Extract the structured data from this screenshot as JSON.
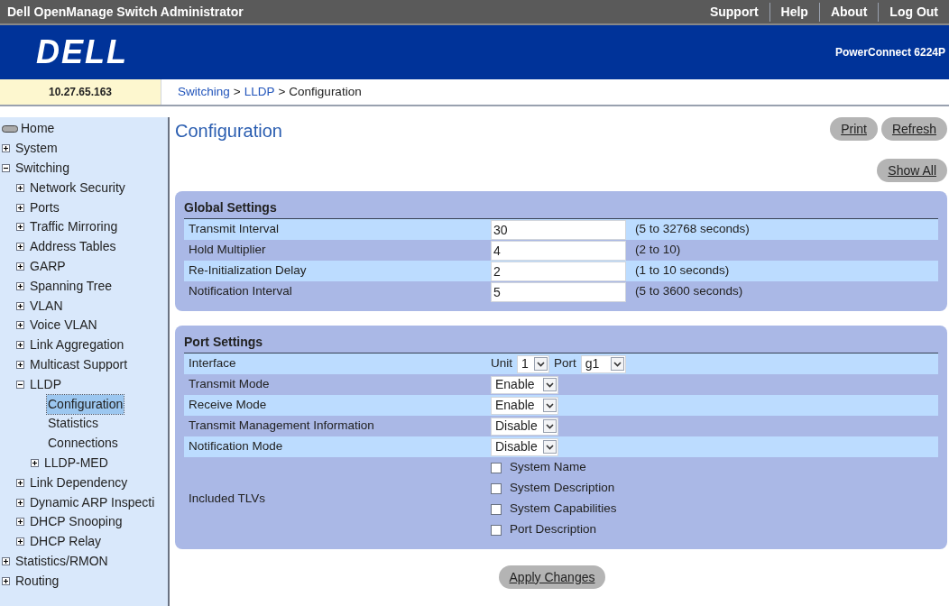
{
  "top_bar": {
    "title": "Dell OpenManage Switch Administrator",
    "links": [
      "Support",
      "Help",
      "About",
      "Log Out"
    ]
  },
  "banner": {
    "logo": "DELL",
    "model": "PowerConnect 6224P"
  },
  "ip_address": "10.27.65.163",
  "breadcrumb": [
    {
      "label": "Switching",
      "link": true
    },
    {
      "label": ">",
      "link": false
    },
    {
      "label": "LLDP",
      "link": true
    },
    {
      "label": ">",
      "link": false
    },
    {
      "label": "Configuration",
      "link": false
    }
  ],
  "sidebar": {
    "items": [
      {
        "label": "Home",
        "kind": "home",
        "selected": false
      },
      {
        "label": "System",
        "kind": "folder",
        "expanded": false,
        "selected": false
      },
      {
        "label": "Switching",
        "kind": "folder",
        "expanded": true,
        "selected": false,
        "children": [
          {
            "label": "Network Security",
            "kind": "folder",
            "expanded": false,
            "selected": false
          },
          {
            "label": "Ports",
            "kind": "folder",
            "expanded": false,
            "selected": false
          },
          {
            "label": "Traffic Mirroring",
            "kind": "folder",
            "expanded": false,
            "selected": false
          },
          {
            "label": "Address Tables",
            "kind": "folder",
            "expanded": false,
            "selected": false
          },
          {
            "label": "GARP",
            "kind": "folder",
            "expanded": false,
            "selected": false
          },
          {
            "label": "Spanning Tree",
            "kind": "folder",
            "expanded": false,
            "selected": false
          },
          {
            "label": "VLAN",
            "kind": "folder",
            "expanded": false,
            "selected": false
          },
          {
            "label": "Voice VLAN",
            "kind": "folder",
            "expanded": false,
            "selected": false
          },
          {
            "label": "Link Aggregation",
            "kind": "folder",
            "expanded": false,
            "selected": false
          },
          {
            "label": "Multicast Support",
            "kind": "folder",
            "expanded": false,
            "selected": false
          },
          {
            "label": "LLDP",
            "kind": "folder",
            "expanded": true,
            "selected": false,
            "children": [
              {
                "label": "Configuration",
                "kind": "page",
                "selected": true
              },
              {
                "label": "Statistics",
                "kind": "page",
                "selected": false
              },
              {
                "label": "Connections",
                "kind": "page",
                "selected": false
              },
              {
                "label": "LLDP-MED",
                "kind": "folder",
                "expanded": false,
                "selected": false
              }
            ]
          },
          {
            "label": "Link Dependency",
            "kind": "folder",
            "expanded": false,
            "selected": false
          },
          {
            "label": "Dynamic ARP Inspecti",
            "kind": "folder",
            "expanded": false,
            "selected": false
          },
          {
            "label": "DHCP Snooping",
            "kind": "folder",
            "expanded": false,
            "selected": false
          },
          {
            "label": "DHCP Relay",
            "kind": "folder",
            "expanded": false,
            "selected": false
          }
        ]
      },
      {
        "label": "Statistics/RMON",
        "kind": "folder",
        "expanded": false,
        "selected": false
      },
      {
        "label": "Routing",
        "kind": "folder",
        "expanded": false,
        "selected": false
      }
    ]
  },
  "page": {
    "title": "Configuration",
    "buttons": [
      "Print",
      "Refresh"
    ],
    "show_all": "Show All"
  },
  "global_settings": {
    "title": "Global Settings",
    "rows": [
      {
        "label": "Transmit Interval",
        "value": "30",
        "range": "(5 to 32768 seconds)"
      },
      {
        "label": "Hold Multiplier",
        "value": "4",
        "range": "(2 to 10)"
      },
      {
        "label": "Re-Initialization Delay",
        "value": "2",
        "range": "(1 to 10 seconds)"
      },
      {
        "label": "Notification Interval",
        "value": "5",
        "range": "(5 to 3600 seconds)"
      }
    ]
  },
  "port_settings": {
    "title": "Port Settings",
    "rows": [
      {
        "kind": "interface",
        "label": "Interface",
        "unit_label": "Unit",
        "unit_value": "1",
        "port_label": "Port",
        "port_value": "g1"
      },
      {
        "kind": "select",
        "label": "Transmit Mode",
        "value": "Enable"
      },
      {
        "kind": "select",
        "label": "Receive Mode",
        "value": "Enable"
      },
      {
        "kind": "select",
        "label": "Transmit Management Information",
        "value": "Disable"
      },
      {
        "kind": "select",
        "label": "Notification Mode",
        "value": "Disable"
      },
      {
        "kind": "checkboxes",
        "label": "Included TLVs",
        "options": [
          {
            "label": "System Name",
            "checked": false
          },
          {
            "label": "System Description",
            "checked": false
          },
          {
            "label": "System Capabilities",
            "checked": false
          },
          {
            "label": "Port Description",
            "checked": false
          }
        ]
      }
    ]
  },
  "apply_button": "Apply Changes"
}
